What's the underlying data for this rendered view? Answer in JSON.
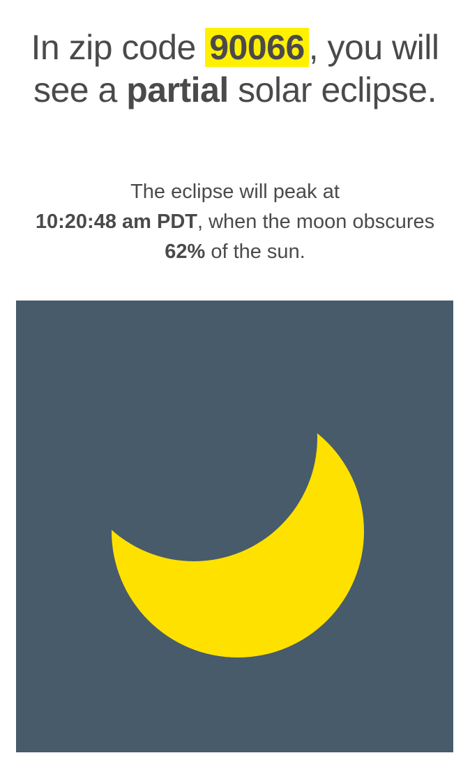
{
  "headline": {
    "prefix": "In zip code ",
    "zip": "90066",
    "middle": ", you will see a ",
    "eclipse_type": "partial",
    "suffix": " solar eclipse."
  },
  "details": {
    "intro": "The eclipse will peak at",
    "peak_time": "10:20:48 am PDT",
    "middle": ", when the moon obscures ",
    "obscured_percent": "62%",
    "suffix": " of the sun."
  },
  "graphic": {
    "obscured_fraction": 0.62,
    "background_color": "#475b6b",
    "sun_color": "#ffe100"
  },
  "colors": {
    "text": "#4a4a4a",
    "highlight": "#ffef00"
  }
}
